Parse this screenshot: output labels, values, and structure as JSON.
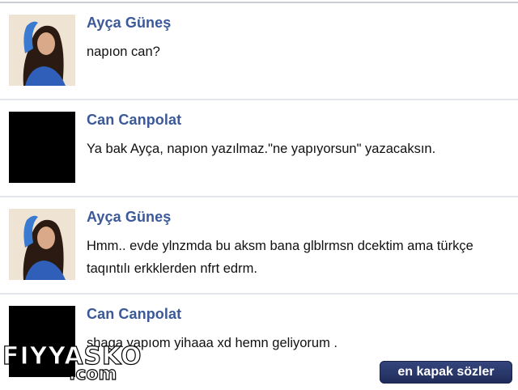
{
  "messages": [
    {
      "sender": "Ayça Güneş",
      "text": "napıon can?",
      "avatar": "girl-photo"
    },
    {
      "sender": "Can Canpolat",
      "text": "Ya bak Ayça, napıon yazılmaz.\"ne yapıyorsun\" yazacaksın.",
      "avatar": "black"
    },
    {
      "sender": "Ayça Güneş",
      "text": "Hmm.. evde ylnzmda bu aksm bana glblrmsn dcektim ama türkçe\ntaqıntılı erkklerden nfrt edrm.",
      "avatar": "girl-photo"
    },
    {
      "sender": "Can Canpolat",
      "text": "shaga yapıom yihaaa xd hemn geliyorum .",
      "avatar": "black"
    }
  ],
  "watermark": {
    "main": "FIYYASKO",
    "sub": ".com"
  },
  "tag": {
    "label": "en kapak sözler"
  },
  "colors": {
    "sender": "#3b5998",
    "divider": "#e3e6ec",
    "tag_bg": "#2a3a6e"
  }
}
